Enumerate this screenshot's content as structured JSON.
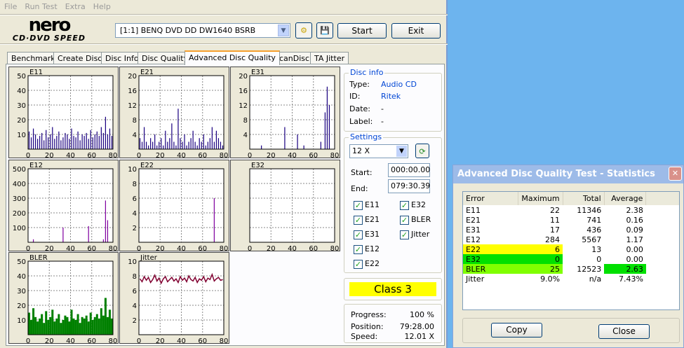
{
  "menu": [
    "File",
    "Run Test",
    "Extra",
    "Help"
  ],
  "logo": {
    "top": "nero",
    "bottom": "CD·DVD SPEED"
  },
  "drive": "[1:1]   BENQ DVD DD DW1640 BSRB",
  "buttons": {
    "start": "Start",
    "exit": "Exit"
  },
  "tabs": [
    "Benchmark",
    "Create Disc",
    "Disc Info",
    "Disc Quality",
    "Advanced Disc Quality",
    "ScanDisc",
    "TA Jitter"
  ],
  "disc_info": {
    "title": "Disc info",
    "type_label": "Type:",
    "type": "Audio CD",
    "id_label": "ID:",
    "id": "Ritek",
    "date_label": "Date:",
    "date": "-",
    "label_label": "Label:",
    "label": "-"
  },
  "settings": {
    "title": "Settings",
    "speed": "12 X",
    "start_label": "Start:",
    "start": "000:00.00",
    "end_label": "End:",
    "end": "079:30.39",
    "checks": [
      "E11",
      "E32",
      "E21",
      "BLER",
      "E31",
      "Jitter",
      "E12",
      "E22"
    ]
  },
  "class": "Class 3",
  "progress": {
    "progress_label": "Progress:",
    "progress": "100 %",
    "position_label": "Position:",
    "position": "79:28.00",
    "speed_label": "Speed:",
    "speed": "12.01 X"
  },
  "dialog": {
    "title": "Advanced Disc Quality Test - Statistics",
    "headers": [
      "Error",
      "Maximum",
      "Total",
      "Average"
    ],
    "rows": [
      [
        "E11",
        "22",
        "11346",
        "2.38"
      ],
      [
        "E21",
        "11",
        "741",
        "0.16"
      ],
      [
        "E31",
        "17",
        "436",
        "0.09"
      ],
      [
        "E12",
        "284",
        "5567",
        "1.17"
      ],
      [
        "E22",
        "6",
        "13",
        "0.00"
      ],
      [
        "E32",
        "0",
        "0",
        "0.00"
      ],
      [
        "BLER",
        "25",
        "12523",
        "2.63"
      ],
      [
        "Jitter",
        "9.0%",
        "n/a",
        "7.43%"
      ]
    ],
    "copy": "Copy",
    "close": "Close"
  },
  "colors": {
    "bars_blue": "#1a0080",
    "bars_purple": "#8000a0",
    "bler": "#008000",
    "jitter": "#800030",
    "e22": "#ffff00",
    "e32": "#00e000",
    "bler_hl": "#80ff00"
  },
  "chart_data": [
    {
      "type": "bar",
      "title": "E11",
      "ylim": [
        0,
        50
      ],
      "yticks": [
        10,
        20,
        30,
        40,
        50
      ],
      "xticks": [
        0,
        20,
        40,
        60,
        80
      ],
      "color": "#1a0080",
      "values": [
        12,
        8,
        14,
        10,
        7,
        9,
        11,
        6,
        13,
        8,
        10,
        15,
        7,
        9,
        12,
        6,
        8,
        11,
        10,
        7,
        14,
        9,
        8,
        12,
        6,
        10,
        9,
        11,
        7,
        13,
        8,
        10,
        12,
        9,
        15,
        11,
        22,
        10,
        14,
        9
      ]
    },
    {
      "type": "bar",
      "title": "E21",
      "ylim": [
        0,
        20
      ],
      "yticks": [
        4,
        8,
        12,
        16,
        20
      ],
      "xticks": [
        0,
        20,
        40,
        60,
        80
      ],
      "color": "#1a0080",
      "values": [
        3,
        2,
        6,
        2,
        1,
        3,
        2,
        4,
        1,
        2,
        3,
        1,
        5,
        2,
        3,
        7,
        2,
        1,
        11,
        3,
        2,
        4,
        1,
        2,
        3,
        5,
        2,
        1,
        3,
        2,
        4,
        1,
        2,
        3,
        6,
        2,
        5,
        3,
        2,
        1
      ]
    },
    {
      "type": "bar",
      "title": "E31",
      "ylim": [
        0,
        20
      ],
      "yticks": [
        4,
        8,
        12,
        16,
        20
      ],
      "xticks": [
        0,
        20,
        40,
        60,
        80
      ],
      "color": "#1a0080",
      "values": [
        0,
        0,
        0,
        0,
        0,
        1,
        0,
        0,
        0,
        0,
        0,
        0,
        0,
        0,
        0,
        0,
        6,
        0,
        0,
        0,
        0,
        0,
        4,
        0,
        0,
        1,
        0,
        0,
        0,
        0,
        0,
        0,
        0,
        2,
        0,
        10,
        17,
        12,
        0,
        0
      ]
    },
    {
      "type": "bar",
      "title": "E12",
      "ylim": [
        0,
        500
      ],
      "yticks": [
        100,
        200,
        300,
        400,
        500
      ],
      "xticks": [
        0,
        20,
        40,
        60,
        80
      ],
      "color": "#8000a0",
      "values": [
        0,
        0,
        20,
        0,
        0,
        0,
        0,
        0,
        0,
        0,
        0,
        0,
        0,
        0,
        0,
        0,
        100,
        0,
        0,
        0,
        0,
        0,
        0,
        0,
        0,
        0,
        0,
        0,
        110,
        0,
        0,
        0,
        0,
        0,
        0,
        20,
        284,
        150,
        0,
        0
      ]
    },
    {
      "type": "bar",
      "title": "E22",
      "ylim": [
        0,
        10
      ],
      "yticks": [
        2,
        4,
        6,
        8,
        10
      ],
      "xticks": [
        0,
        20,
        40,
        60,
        80
      ],
      "color": "#8000a0",
      "values": [
        0,
        0,
        0,
        0,
        0,
        0,
        0,
        0,
        0,
        0,
        0,
        0,
        0,
        0,
        0,
        0,
        0,
        0,
        0,
        0,
        0,
        0,
        0,
        0,
        0,
        0,
        0,
        0,
        0,
        0,
        0,
        0,
        0,
        0,
        0,
        6,
        0,
        0,
        0,
        0
      ]
    },
    {
      "type": "bar",
      "title": "E32",
      "ylim": [
        0,
        20
      ],
      "yticks": [],
      "xticks": [
        0,
        20,
        40,
        60,
        80
      ],
      "color": "#8000a0",
      "values": []
    },
    {
      "type": "bar",
      "title": "BLER",
      "ylim": [
        0,
        50
      ],
      "yticks": [
        10,
        20,
        30,
        40,
        50
      ],
      "xticks": [
        0,
        20,
        40,
        60,
        80
      ],
      "color": "#008000",
      "fill": true,
      "values": [
        15,
        10,
        18,
        12,
        9,
        11,
        14,
        8,
        16,
        10,
        12,
        17,
        9,
        11,
        14,
        8,
        10,
        13,
        12,
        9,
        17,
        11,
        10,
        14,
        8,
        12,
        11,
        13,
        9,
        15,
        10,
        12,
        14,
        11,
        18,
        13,
        25,
        12,
        17,
        11
      ]
    },
    {
      "type": "line",
      "title": "Jitter",
      "ylim": [
        0,
        10
      ],
      "yticks": [
        2,
        4,
        6,
        8,
        10
      ],
      "xticks": [
        0,
        20,
        40,
        60,
        80
      ],
      "color": "#800030",
      "values": [
        7.6,
        7.2,
        7.9,
        7.4,
        7.8,
        7.1,
        7.5,
        8.1,
        7.3,
        7.7,
        7.0,
        7.6,
        7.9,
        7.2,
        7.5,
        7.8,
        7.3,
        7.6,
        7.1,
        7.9,
        7.4,
        7.7,
        7.2,
        8.0,
        7.5,
        7.3,
        7.8,
        7.1,
        7.6,
        7.4,
        7.9,
        7.2,
        7.7,
        7.5,
        8.2,
        7.3,
        7.6,
        7.8,
        7.4,
        7.5
      ]
    }
  ]
}
